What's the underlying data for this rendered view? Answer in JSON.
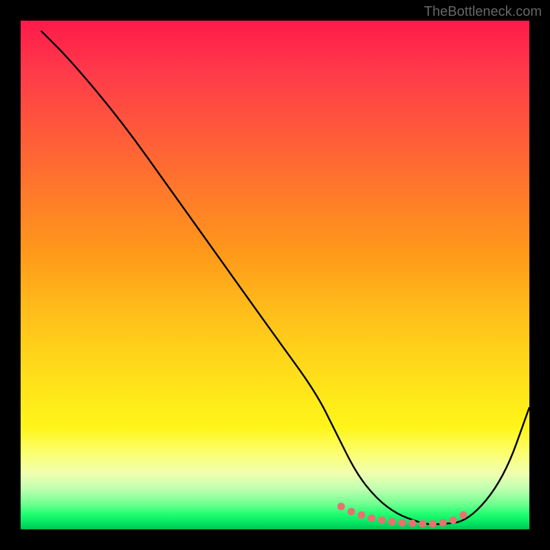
{
  "watermark": "TheBottleneck.com",
  "chart_data": {
    "type": "line",
    "title": "",
    "xlabel": "",
    "ylabel": "",
    "ylim": [
      0,
      100
    ],
    "xlim": [
      0,
      100
    ],
    "series": [
      {
        "name": "bottleneck-curve",
        "x": [
          4,
          10,
          20,
          30,
          40,
          50,
          58,
          62,
          66,
          70,
          74,
          78,
          80,
          82,
          88,
          95,
          100
        ],
        "values": [
          98,
          92,
          80,
          66,
          52,
          38,
          27,
          19,
          11,
          6,
          3,
          1.5,
          1,
          1,
          1.5,
          10,
          24
        ]
      }
    ],
    "markers": {
      "name": "highlight-dots",
      "color": "#e87070",
      "x": [
        63,
        65,
        67,
        69,
        71,
        73,
        75,
        77,
        79,
        81,
        83,
        85,
        87
      ],
      "values": [
        4.5,
        3.5,
        2.8,
        2.2,
        1.8,
        1.5,
        1.3,
        1.2,
        1.1,
        1.1,
        1.3,
        1.8,
        2.8
      ]
    }
  }
}
